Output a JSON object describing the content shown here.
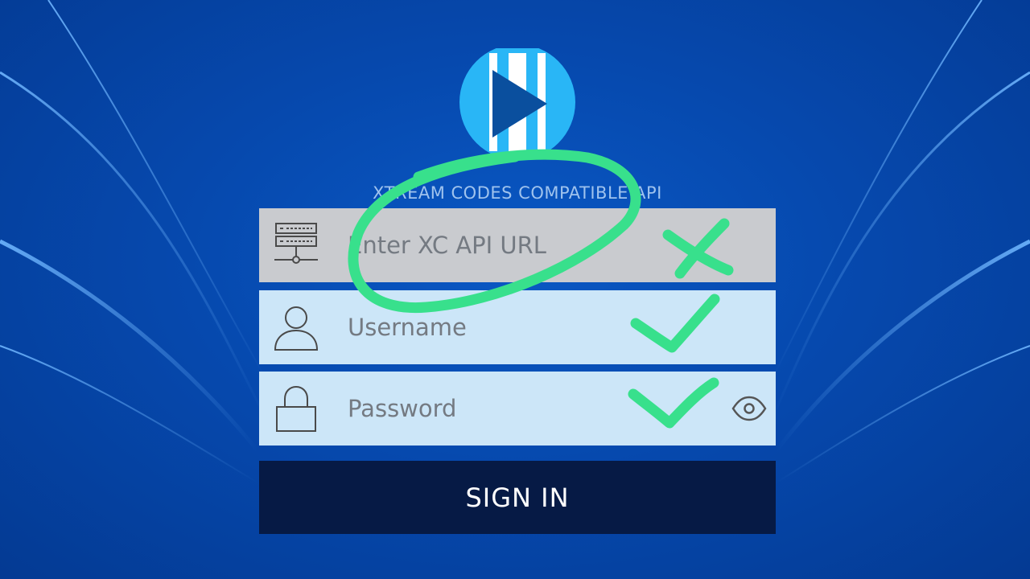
{
  "app": {
    "subtitle": "XTREAM CODES COMPATIBLE API"
  },
  "form": {
    "url_placeholder": "Enter XC API URL",
    "url_value": "",
    "username_placeholder": "Username",
    "username_value": "",
    "password_placeholder": "Password",
    "password_value": "",
    "signin_label": "SIGN IN"
  },
  "icons": {
    "logo": "play-logo-icon",
    "url": "server-icon",
    "username": "user-icon",
    "password": "lock-icon",
    "toggle": "eye-icon"
  },
  "colors": {
    "background": "#0649ae",
    "logo_circle": "#29b6f6",
    "url_field": "#c9cbcf",
    "input_field": "#cce6f8",
    "signin_button": "#061a45",
    "annotation": "#38e08c"
  }
}
